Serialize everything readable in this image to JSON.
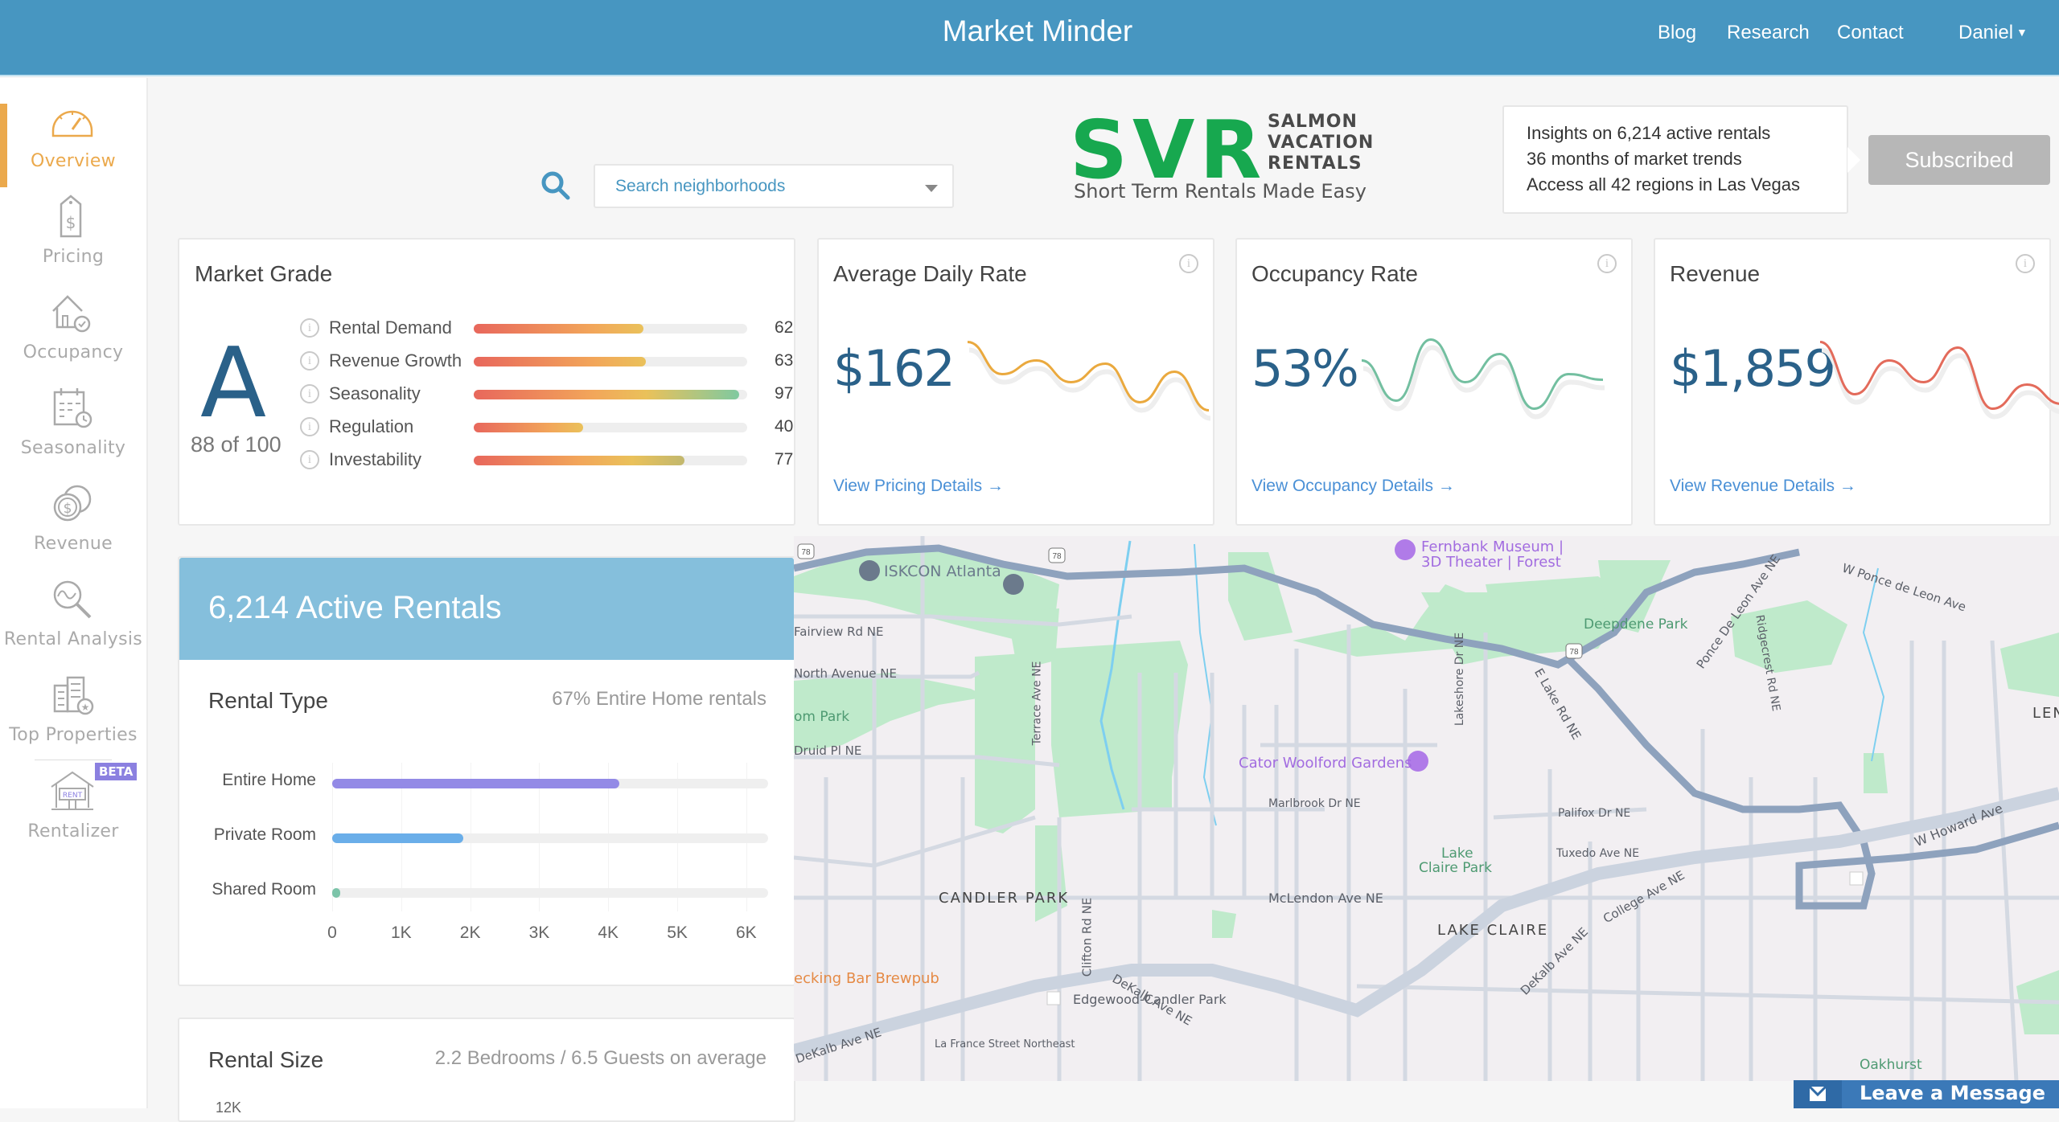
{
  "header": {
    "title": "Market Minder",
    "nav": [
      "Blog",
      "Research",
      "Contact"
    ],
    "user": "Daniel"
  },
  "sidebar": {
    "items": [
      {
        "label": "Overview",
        "icon": "speedometer-icon",
        "active": true
      },
      {
        "label": "Pricing",
        "icon": "price-tag-icon",
        "active": false
      },
      {
        "label": "Occupancy",
        "icon": "house-check-icon",
        "active": false
      },
      {
        "label": "Seasonality",
        "icon": "calendar-clock-icon",
        "active": false
      },
      {
        "label": "Revenue",
        "icon": "coins-icon",
        "active": false
      },
      {
        "label": "Rental Analysis",
        "icon": "magnifier-chart-icon",
        "active": false
      },
      {
        "label": "Top Properties",
        "icon": "building-star-icon",
        "active": false
      },
      {
        "label": "Rentalizer",
        "icon": "rent-sign-house-icon",
        "active": false,
        "badge": "BETA",
        "sign_text": "RENT"
      }
    ]
  },
  "search": {
    "placeholder": "Search neighborhoods"
  },
  "logo": {
    "mark": "SVR",
    "line1": "SALMON",
    "line2": "VACATION",
    "line3": "RENTALS",
    "tagline": "Short Term Rentals Made Easy"
  },
  "insights": {
    "lines": [
      "Insights on 6,214 active rentals",
      "36 months of market trends",
      "Access all 42 regions in Las Vegas"
    ],
    "button": "Subscribed"
  },
  "market_grade": {
    "title": "Market Grade",
    "grade": "A",
    "score_text": "88 of 100",
    "metrics": [
      {
        "name": "Rental Demand",
        "value": 62
      },
      {
        "name": "Revenue Growth",
        "value": 63
      },
      {
        "name": "Seasonality",
        "value": 97
      },
      {
        "name": "Regulation",
        "value": 40
      },
      {
        "name": "Investability",
        "value": 77
      }
    ]
  },
  "kpis": [
    {
      "title": "Average Daily Rate",
      "value": "$162",
      "link": "View Pricing Details →",
      "color": "#eaa93e",
      "trend": [
        0.95,
        0.55,
        0.72,
        0.45,
        0.68,
        0.2,
        0.58,
        0.1
      ]
    },
    {
      "title": "Occupancy Rate",
      "value": "53%",
      "link": "View Occupancy Details →",
      "color": "#73bfa0",
      "trend": [
        0.72,
        0.22,
        0.98,
        0.45,
        0.8,
        0.12,
        0.55,
        0.48
      ]
    },
    {
      "title": "Revenue",
      "value": "$1,859",
      "link": "View Revenue Details →",
      "color": "#e36b5b",
      "trend": [
        0.95,
        0.3,
        0.72,
        0.45,
        0.88,
        0.12,
        0.42,
        0.18
      ]
    }
  ],
  "active_rentals": {
    "title": "6,214 Active Rentals",
    "rental_type": {
      "title": "Rental Type",
      "summary": "67% Entire Home rentals"
    },
    "rental_size": {
      "title": "Rental Size",
      "summary": "2.2 Bedrooms / 6.5 Guests on average",
      "first_tick": "12K"
    }
  },
  "chart_data": {
    "type": "bar",
    "orientation": "horizontal",
    "title": "Rental Type",
    "categories": [
      "Entire Home",
      "Private Room",
      "Shared Room"
    ],
    "values": [
      4160,
      1900,
      50
    ],
    "colors": [
      "#938ae6",
      "#6aaee9",
      "#7cc4a9"
    ],
    "xlim": [
      0,
      6200
    ],
    "xticks": [
      "0",
      "1K",
      "2K",
      "3K",
      "4K",
      "5K",
      "6K"
    ],
    "xtick_values": [
      0,
      1000,
      2000,
      3000,
      4000,
      5000,
      6000
    ],
    "grid": true
  },
  "map": {
    "labels": [
      {
        "text": "ISKCON Atlanta",
        "kind": "poi-dark"
      },
      {
        "text": "Fernbank Museum |",
        "kind": "poi"
      },
      {
        "text": "3D Theater | Forest",
        "kind": "poi"
      },
      {
        "text": "Fairview Rd NE",
        "kind": "street"
      },
      {
        "text": "North Avenue NE",
        "kind": "street"
      },
      {
        "text": "om Park",
        "kind": "park"
      },
      {
        "text": "Druid Pl NE",
        "kind": "street"
      },
      {
        "text": "Deepdene Park",
        "kind": "park"
      },
      {
        "text": "W Ponce de Leon Ave",
        "kind": "street"
      },
      {
        "text": "Ponce De Leon Ave NE",
        "kind": "street"
      },
      {
        "text": "E Lake Rd NE",
        "kind": "street"
      },
      {
        "text": "Ridgecrest Rd NE",
        "kind": "street"
      },
      {
        "text": "Lakeshore Dr NE",
        "kind": "street"
      },
      {
        "text": "Terrace Ave NE",
        "kind": "street"
      },
      {
        "text": "Cator Woolford Gardens",
        "kind": "poi"
      },
      {
        "text": "Marlbrook Dr NE",
        "kind": "street"
      },
      {
        "text": "Palifox Dr NE",
        "kind": "street"
      },
      {
        "text": "Tuxedo Ave NE",
        "kind": "street"
      },
      {
        "text": "Lake",
        "kind": "park"
      },
      {
        "text": "Claire Park",
        "kind": "park"
      },
      {
        "text": "LENO",
        "kind": "hood"
      },
      {
        "text": "CANDLER PARK",
        "kind": "hood"
      },
      {
        "text": "McLendon Ave NE",
        "kind": "street"
      },
      {
        "text": "LAKE CLAIRE",
        "kind": "hood"
      },
      {
        "text": "W Howard Ave",
        "kind": "street"
      },
      {
        "text": "College Ave NE",
        "kind": "street"
      },
      {
        "text": "DeKalb Ave NE",
        "kind": "street"
      },
      {
        "text": "Edgewood-Candler Park",
        "kind": "station"
      },
      {
        "text": "ecking Bar Brewpub",
        "kind": "food"
      },
      {
        "text": "La France Street Northeast",
        "kind": "street"
      },
      {
        "text": "Clifton Rd NE",
        "kind": "street"
      },
      {
        "text": "Oakhurst",
        "kind": "park"
      },
      {
        "text": "78",
        "kind": "shield"
      }
    ]
  },
  "chat": {
    "label": "Leave a Message"
  }
}
